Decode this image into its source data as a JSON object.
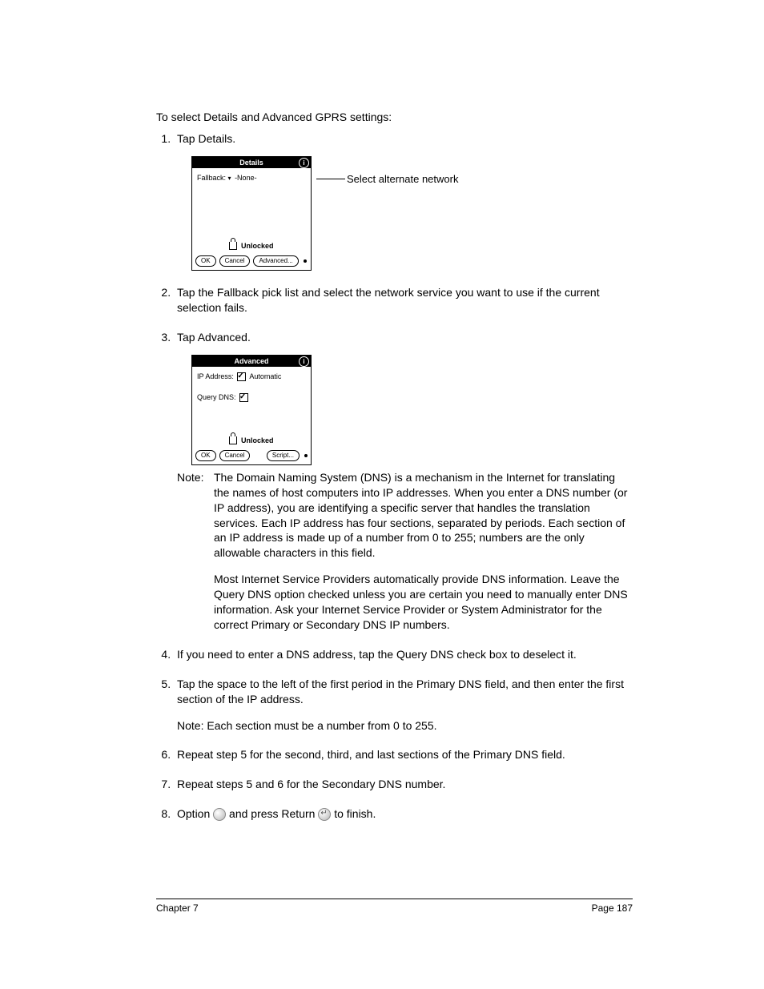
{
  "heading": "To select Details and Advanced GPRS settings:",
  "steps": {
    "s1": "Tap Details.",
    "s2": "Tap the Fallback pick list and select the network service you want to use if the current selection fails.",
    "s3": "Tap Advanced.",
    "s4": "If you need to enter a DNS address, tap the Query DNS check box to deselect it.",
    "s5": "Tap the space to the left of the first period in the Primary DNS field, and then enter the first section of the IP address.",
    "s5_note": "Note: Each section must be a number from 0 to 255.",
    "s6": "Repeat step 5 for the second, third, and last sections of the Primary DNS field.",
    "s7": "Repeat steps 5 and 6 for the Secondary DNS number.",
    "s8_a": "Option ",
    "s8_b": " and press Return ",
    "s8_c": " to finish."
  },
  "callout1": "Select alternate network",
  "details_dialog": {
    "title": "Details",
    "fallback_label": "Fallback:",
    "fallback_value": "-None-",
    "unlocked": "Unlocked",
    "ok": "OK",
    "cancel": "Cancel",
    "advanced": "Advanced..."
  },
  "advanced_dialog": {
    "title": "Advanced",
    "ip_label": "IP Address:",
    "ip_value": "Automatic",
    "query_dns_label": "Query DNS:",
    "unlocked": "Unlocked",
    "ok": "OK",
    "cancel": "Cancel",
    "script": "Script..."
  },
  "note": {
    "label": "Note:",
    "p1": "The Domain Naming System (DNS) is a mechanism in the Internet for translating the names of host computers into IP addresses. When you enter a DNS number (or IP address), you are identifying a specific server that handles the translation services. Each IP address has four sections, separated by periods. Each section of an IP address is made up of a number from 0 to 255; numbers are the only allowable characters in this field.",
    "p2": "Most Internet Service Providers automatically provide DNS information. Leave the Query DNS option checked unless you are certain you need to manually enter DNS information. Ask your Internet Service Provider or System Administrator for the correct Primary or Secondary DNS IP numbers."
  },
  "footer": {
    "left": "Chapter 7",
    "right": "Page 187"
  }
}
